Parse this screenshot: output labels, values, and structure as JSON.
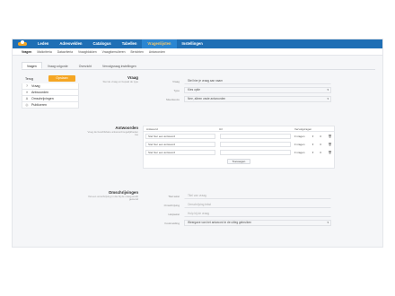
{
  "topnav": {
    "items": [
      "Leden",
      "Adresvelden",
      "Catalogus",
      "Tabellen",
      "Vragenlijsten",
      "Instellingen"
    ],
    "active_index": 4
  },
  "subnav": {
    "items": [
      "Vragen",
      "Mailcriteria",
      "Datacriteria",
      "Vraagblokken",
      "Vraagformulieren",
      "Berichten",
      "Antwoorden"
    ],
    "active_index": 0
  },
  "tabs": {
    "items": [
      "Vragen",
      "Vraag volgorde",
      "Overzicht",
      "Vervolgvraag instellingen"
    ],
    "active_index": 0
  },
  "leftmenu": {
    "back_label": "Terug",
    "save_label": "Opslaan",
    "items": [
      {
        "icon": "question-icon",
        "glyph": "?",
        "label": "Vraag"
      },
      {
        "icon": "list-icon",
        "glyph": "≡",
        "label": "Antwoorden"
      },
      {
        "icon": "text-icon",
        "glyph": "A",
        "label": "Omschrijvingen"
      },
      {
        "icon": "publish-icon",
        "glyph": "◎",
        "label": "Publiceren"
      }
    ]
  },
  "vraag": {
    "title": "Vraag",
    "desc": "Stel de vraag en bepaal de type",
    "fields": [
      {
        "label": "Vraag",
        "value": "Stel hier je vraag aan naam",
        "type": "text"
      },
      {
        "label": "Type",
        "value": "Kies optie",
        "type": "select"
      },
      {
        "label": "Meerkeuze",
        "value": "Nee, alleen vaste antwoorden",
        "type": "select"
      }
    ]
  },
  "antwoorden": {
    "title": "Antwoorden",
    "desc": "Voeg de beschikbare antwoordmogelijkheden toe",
    "headers": {
      "answer": "Antwoord",
      "url": "Url",
      "condition": "Vervolgvragen"
    },
    "rows": [
      {
        "answer": "Stel hier een antwoord",
        "condition": "0 vragen",
        "count": "0"
      },
      {
        "answer": "Stel hier een antwoord",
        "condition": "0 vragen",
        "count": "0"
      },
      {
        "answer": "Stel hier een antwoord",
        "condition": "0 vragen",
        "count": "0"
      }
    ],
    "add_label": "Toevoegen"
  },
  "omschrijving": {
    "title": "Omschrijvingen",
    "desc": "Vul een omschrijving in die bij de vraag wordt getoond",
    "fields": [
      {
        "label": "Titel tekst",
        "value": "Titel van vraag",
        "type": "text"
      },
      {
        "label": "Omschrijving",
        "value": "Omschrijving tekst",
        "type": "text"
      },
      {
        "label": "Hulptekst",
        "value": "Hulp bij de vraag",
        "type": "text"
      },
      {
        "label": "Foutmelding",
        "value": "Weergave van het antwoord in de uitleg gebruiken",
        "type": "select"
      }
    ]
  }
}
